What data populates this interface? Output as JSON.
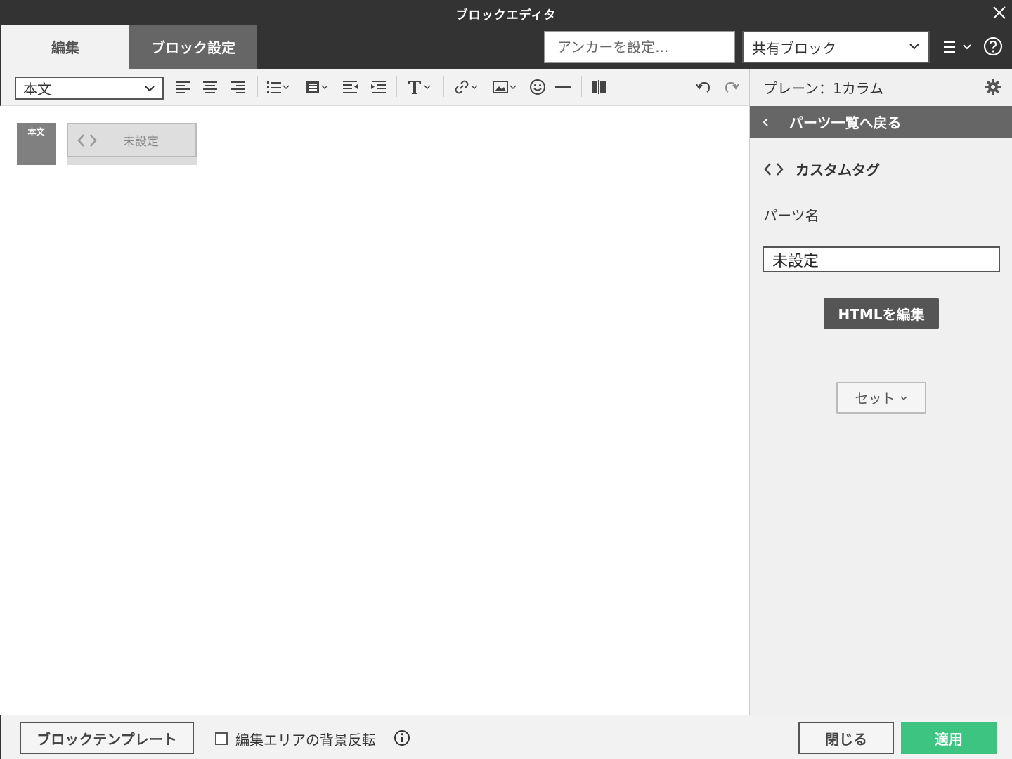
{
  "window": {
    "title": "ブロックエディタ"
  },
  "header": {
    "tabs": [
      {
        "label": "編集"
      },
      {
        "label": "ブロック設定"
      }
    ],
    "anchor_placeholder": "アンカーを設定...",
    "shared_block_value": "共有ブロック"
  },
  "toolbar": {
    "format_value": "本文"
  },
  "editor": {
    "block_label": "本文",
    "custom_tag_label": "未設定"
  },
  "sidebar": {
    "plane_label": "プレーン：1カラム",
    "back_label": "パーツ一覧へ戻る",
    "part_type": "カスタムタグ",
    "part_name_label": "パーツ名",
    "part_name_value": "未設定",
    "edit_html_label": "HTMLを編集",
    "set_label": "セット"
  },
  "footer": {
    "template_label": "ブロックテンプレート",
    "invert_label": "編集エリアの背景反転",
    "invert_checked": false,
    "close_label": "閉じる",
    "apply_label": "適用"
  },
  "colors": {
    "dark_bar": "#333333",
    "active_tab": "#666666",
    "apply_green": "#3cc480"
  }
}
